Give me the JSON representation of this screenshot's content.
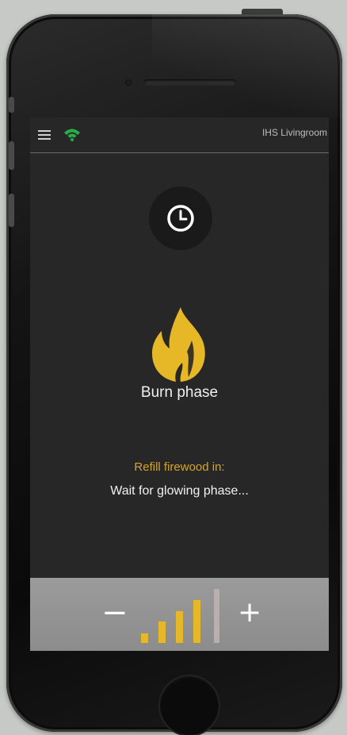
{
  "header": {
    "room_name": "IHS Livingroom"
  },
  "icons": {
    "menu": "menu-icon",
    "wifi": "wifi-icon",
    "clock": "clock-icon",
    "flame": "flame-icon"
  },
  "main": {
    "phase_label": "Burn phase",
    "refill_label": "Refill firewood in:",
    "wait_label": "Wait for glowing phase..."
  },
  "controls": {
    "minus_label": "−",
    "plus_label": "+",
    "power_level": 4,
    "power_max": 5
  },
  "colors": {
    "accent": "#e6b726",
    "wifi": "#27b04a",
    "inactive_bar": "#b9afb0",
    "screen_bg": "#272727"
  }
}
